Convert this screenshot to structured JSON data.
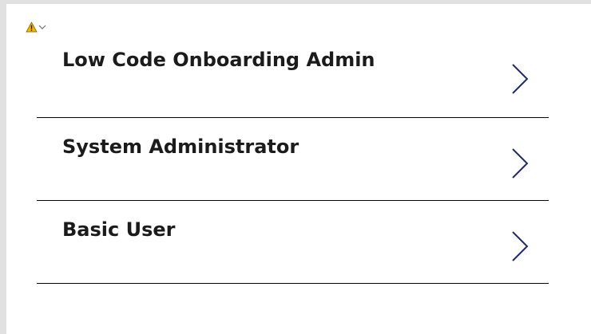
{
  "colors": {
    "background": "#e1e1e1",
    "panel": "#ffffff",
    "text": "#1b1b1b",
    "divider": "#000000",
    "chevron": "#1f2a6b",
    "warning": "#f4b400"
  },
  "header": {
    "icons": [
      "warning-icon",
      "chevron-down-icon"
    ]
  },
  "roles": {
    "items": [
      {
        "label": "Low Code Onboarding Admin",
        "icon": "chevron-right-icon"
      },
      {
        "label": "System Administrator",
        "icon": "chevron-right-icon"
      },
      {
        "label": "Basic User",
        "icon": "chevron-right-icon"
      }
    ]
  }
}
